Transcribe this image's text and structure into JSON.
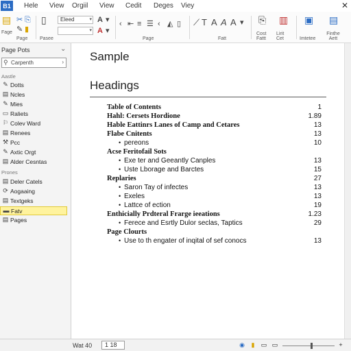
{
  "app": {
    "badge": "B1"
  },
  "menu": [
    "Hele",
    "View",
    "Orgiil",
    "View",
    "Cedit",
    "Deges",
    "Viey"
  ],
  "ribbon": {
    "font_combo": "Eleed",
    "size_combo": "",
    "groups": [
      "Page",
      "Pasee",
      "Page",
      "Fatt",
      "Cost Fattt",
      "Lirit Cet",
      "Imtetee",
      "Finthe Aett"
    ],
    "paste_label": "Fage"
  },
  "nav": {
    "title": "Page Pots",
    "search_placeholder": "Carpenth",
    "section_1": "Aastle",
    "items_1": [
      {
        "icon": "✎",
        "label": "Dotts"
      },
      {
        "icon": "▤",
        "label": "Ncles"
      },
      {
        "icon": "✎",
        "label": "Mies"
      },
      {
        "icon": "▭",
        "label": "Raliets"
      },
      {
        "icon": "⚐",
        "label": "Colev Ward"
      },
      {
        "icon": "▤",
        "label": "Renees"
      },
      {
        "icon": "⚒",
        "label": "Pcc"
      },
      {
        "icon": "✎",
        "label": "Axtic Orgt"
      },
      {
        "icon": "▤",
        "label": "Alder Cesntas"
      }
    ],
    "section_2": "Prones",
    "items_2": [
      {
        "icon": "▤",
        "label": "Deler Catels"
      },
      {
        "icon": "⟳",
        "label": "Aogaaing"
      },
      {
        "icon": "▤",
        "label": "Textgeks"
      },
      {
        "icon": "▬",
        "label": "Fatv",
        "selected": true
      },
      {
        "icon": "▤",
        "label": "Pages"
      }
    ]
  },
  "document": {
    "title": "Sample",
    "heading": "Headings",
    "toc": [
      {
        "text": "Table of Contents",
        "page": "1",
        "level": 0
      },
      {
        "text": "Hahl:  Cersets Hordione",
        "page": "1.89",
        "level": 0
      },
      {
        "text": "Hable  Eattinrs Lanes of Camp and Cetares",
        "page": "13",
        "level": 0
      },
      {
        "text": "Flabe Cnitents",
        "page": "13",
        "level": 0
      },
      {
        "text": "pereons",
        "page": "10",
        "level": 1
      },
      {
        "text": "Acse Feritofail Sots",
        "page": "",
        "level": 0
      },
      {
        "text": "Exe ter and Geeantly Canples",
        "page": "13",
        "level": 1
      },
      {
        "text": "Uste Lborage and Barctes",
        "page": "15",
        "level": 1
      },
      {
        "text": "Replaries",
        "page": "27",
        "level": 0
      },
      {
        "text": "Saron Tay of infectes",
        "page": "13",
        "level": 1
      },
      {
        "text": "Exeles",
        "page": "13",
        "level": 1
      },
      {
        "text": "Lattce of ection",
        "page": "19",
        "level": 1
      },
      {
        "text": "Enthicially Prdteral Frarge ieeations",
        "page": "1.23",
        "level": 0
      },
      {
        "text": "Ferece and Esrtly Dulor seclas, Taptics",
        "page": "29",
        "level": 1
      },
      {
        "text": "Page Clourts",
        "page": "",
        "level": 0
      },
      {
        "text": "Use to th engater of inqital of sef conocs",
        "page": "13",
        "level": 1
      }
    ]
  },
  "status": {
    "words": "Wat 40",
    "page_box": "1 18",
    "zoom": 0.55
  },
  "colors": {
    "accent": "#2b6cc4",
    "selected_bg": "#fff39e"
  }
}
